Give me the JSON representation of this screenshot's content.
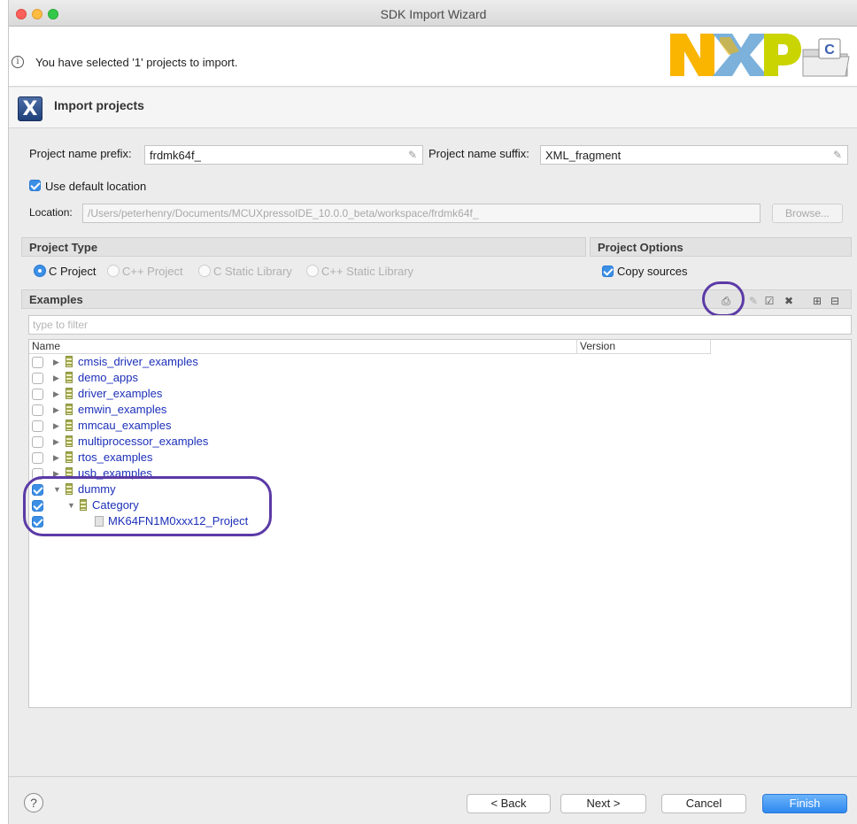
{
  "window": {
    "title": "SDK Import Wizard"
  },
  "header": {
    "message": "You have selected '1' projects to import."
  },
  "subheader": {
    "title": "Import projects",
    "icon": "import-x-icon"
  },
  "form": {
    "prefix_label": "Project name prefix:",
    "prefix_value": "frdmk64f_",
    "suffix_label": "Project name suffix:",
    "suffix_value": "XML_fragment",
    "use_default_label": "Use default location",
    "use_default_checked": true,
    "location_label": "Location:",
    "location_value": "/Users/peterhenry/Documents/MCUXpressoIDE_10.0.0_beta/workspace/frdmk64f_",
    "browse_label": "Browse..."
  },
  "project_type": {
    "title": "Project Type",
    "options": [
      "C Project",
      "C++ Project",
      "C Static Library",
      "C++ Static Library"
    ],
    "selected": "C Project"
  },
  "project_options": {
    "title": "Project Options",
    "copy_sources_label": "Copy sources",
    "copy_sources_checked": true
  },
  "examples": {
    "title": "Examples",
    "filter_placeholder": "type to filter",
    "columns": [
      "Name",
      "Version"
    ],
    "items": [
      {
        "label": "cmsis_driver_examples",
        "checked": false
      },
      {
        "label": "demo_apps",
        "checked": false
      },
      {
        "label": "driver_examples",
        "checked": false
      },
      {
        "label": "emwin_examples",
        "checked": false
      },
      {
        "label": "mmcau_examples",
        "checked": false
      },
      {
        "label": "multiprocessor_examples",
        "checked": false
      },
      {
        "label": "rtos_examples",
        "checked": false
      },
      {
        "label": "usb_examples",
        "checked": false
      },
      {
        "label": "dummy",
        "checked": true
      },
      {
        "label": "Category",
        "checked": true
      },
      {
        "label": "MK64FN1M0xxx12_Project",
        "checked": true
      }
    ]
  },
  "buttons": {
    "back": "< Back",
    "next": "Next >",
    "cancel": "Cancel",
    "finish": "Finish"
  },
  "colors": {
    "accent": "#3b8fe5",
    "highlight_circle": "#5b3aa6",
    "tree_link": "#1c2fb8"
  }
}
